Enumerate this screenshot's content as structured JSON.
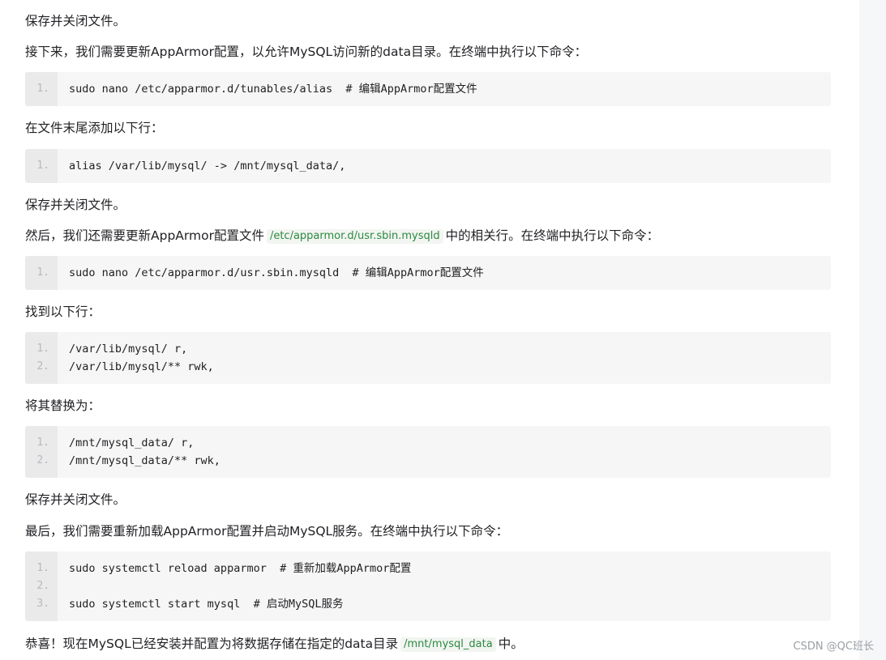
{
  "paragraphs": {
    "p1": "保存并关闭文件。",
    "p2": "接下来，我们需要更新AppArmor配置，以允许MySQL访问新的data目录。在终端中执行以下命令：",
    "p3": "在文件末尾添加以下行：",
    "p4": "保存并关闭文件。",
    "p5_before": "然后，我们还需要更新AppArmor配置文件",
    "p5_code": "/etc/apparmor.d/usr.sbin.mysqld",
    "p5_after": "中的相关行。在终端中执行以下命令：",
    "p6": "找到以下行：",
    "p7": "将其替换为：",
    "p8": "保存并关闭文件。",
    "p9": "最后，我们需要重新加载AppArmor配置并启动MySQL服务。在终端中执行以下命令：",
    "p10_before": "恭喜！现在MySQL已经安装并配置为将数据存储在指定的data目录",
    "p10_code": "/mnt/mysql_data",
    "p10_after": "中。"
  },
  "code_blocks": [
    {
      "lines": [
        {
          "num": "1.",
          "text": "sudo nano /etc/apparmor.d/tunables/alias  # 编辑AppArmor配置文件"
        }
      ]
    },
    {
      "lines": [
        {
          "num": "1.",
          "text": "alias /var/lib/mysql/ -> /mnt/mysql_data/,"
        }
      ]
    },
    {
      "lines": [
        {
          "num": "1.",
          "text": "sudo nano /etc/apparmor.d/usr.sbin.mysqld  # 编辑AppArmor配置文件"
        }
      ]
    },
    {
      "lines": [
        {
          "num": "1.",
          "text": "/var/lib/mysql/ r,"
        },
        {
          "num": "2.",
          "text": "/var/lib/mysql/** rwk,"
        }
      ]
    },
    {
      "lines": [
        {
          "num": "1.",
          "text": "/mnt/mysql_data/ r,"
        },
        {
          "num": "2.",
          "text": "/mnt/mysql_data/** rwk,"
        }
      ]
    },
    {
      "lines": [
        {
          "num": "1.",
          "text": "sudo systemctl reload apparmor  # 重新加载AppArmor配置"
        },
        {
          "num": "2.",
          "text": ""
        },
        {
          "num": "3.",
          "text": "sudo systemctl start mysql  # 启动MySQL服务"
        }
      ]
    }
  ],
  "watermark": "CSDN @QC班长",
  "colors": {
    "code_bg": "#f6f6f6",
    "gutter_bg": "#eaeaea",
    "inline_code_fg": "#2b8a3e",
    "text": "#222226"
  }
}
